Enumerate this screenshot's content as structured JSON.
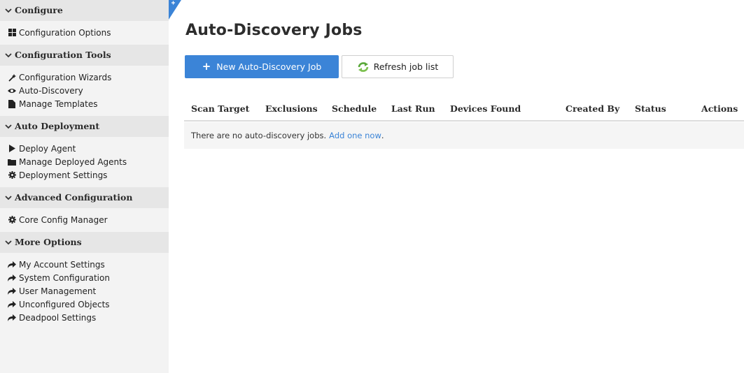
{
  "sidebar": {
    "sections": [
      {
        "title": "Configure",
        "items": [
          {
            "label": "Configuration Options",
            "icon": "grid-icon"
          }
        ]
      },
      {
        "title": "Configuration Tools",
        "items": [
          {
            "label": "Configuration Wizards",
            "icon": "magic-wand-icon"
          },
          {
            "label": "Auto-Discovery",
            "icon": "eye-icon"
          },
          {
            "label": "Manage Templates",
            "icon": "file-icon"
          }
        ]
      },
      {
        "title": "Auto Deployment",
        "items": [
          {
            "label": "Deploy Agent",
            "icon": "play-icon"
          },
          {
            "label": "Manage Deployed Agents",
            "icon": "folder-icon"
          },
          {
            "label": "Deployment Settings",
            "icon": "gear-icon"
          }
        ]
      },
      {
        "title": "Advanced Configuration",
        "items": [
          {
            "label": "Core Config Manager",
            "icon": "gear-icon"
          }
        ]
      },
      {
        "title": "More Options",
        "items": [
          {
            "label": "My Account Settings",
            "icon": "share-arrow-icon"
          },
          {
            "label": "System Configuration",
            "icon": "share-arrow-icon"
          },
          {
            "label": "User Management",
            "icon": "share-arrow-icon"
          },
          {
            "label": "Unconfigured Objects",
            "icon": "share-arrow-icon"
          },
          {
            "label": "Deadpool Settings",
            "icon": "share-arrow-icon"
          }
        ]
      }
    ]
  },
  "main": {
    "title": "Auto-Discovery Jobs",
    "new_button_label": "New Auto-Discovery Job",
    "refresh_button_label": "Refresh job list",
    "table": {
      "columns": [
        "Scan Target",
        "Exclusions",
        "Schedule",
        "Last Run",
        "Devices Found",
        "Created By",
        "Status",
        "Actions"
      ],
      "empty_text": "There are no auto-discovery jobs.",
      "empty_link": "Add one now",
      "empty_suffix": "."
    }
  },
  "colors": {
    "accent": "#3b84d7",
    "sidebar_bg": "#f3f3f3",
    "section_header_bg": "#e6e6e6",
    "empty_row_bg": "#f5f5f5"
  }
}
